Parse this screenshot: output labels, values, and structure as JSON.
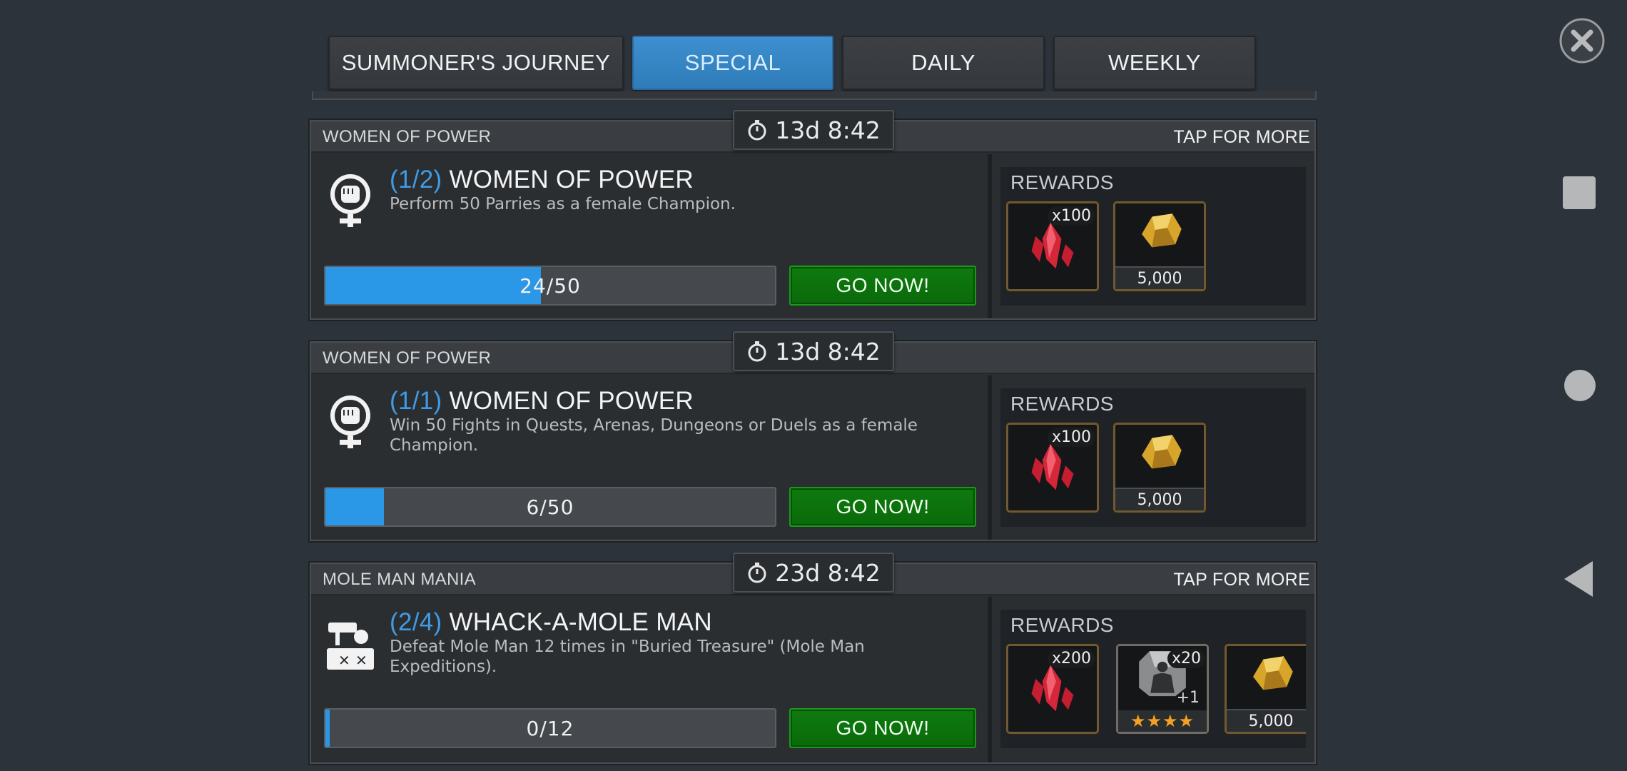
{
  "tabs": [
    {
      "label": "SUMMONER'S JOURNEY",
      "active": false
    },
    {
      "label": "SPECIAL",
      "active": true
    },
    {
      "label": "DAILY",
      "active": false
    },
    {
      "label": "WEEKLY",
      "active": false
    }
  ],
  "cards": [
    {
      "category": "WOMEN OF POWER",
      "tap_more": "TAP FOR MORE",
      "timer": "13d 8:42",
      "icon": "female-fist-icon",
      "progress_step": "(1/2)",
      "title": "WOMEN OF POWER",
      "description": "Perform 50 Parries as a female Champion.",
      "progress_text": "24/50",
      "progress_fraction": 0.48,
      "go_label": "GO NOW!",
      "rewards_title": "REWARDS",
      "rewards": [
        {
          "icon": "red-crystal-shard-icon",
          "count": "x100"
        },
        {
          "icon": "gold-nugget-icon",
          "label": "5,000"
        }
      ]
    },
    {
      "category": "WOMEN OF POWER",
      "tap_more": "",
      "timer": "13d 8:42",
      "icon": "female-fist-icon",
      "progress_step": "(1/1)",
      "title": "WOMEN OF POWER",
      "description": "Win 50 Fights in Quests, Arenas, Dungeons or Duels as a female Champion.",
      "progress_text": "6/50",
      "progress_fraction": 0.12,
      "go_label": "GO NOW!",
      "rewards_title": "REWARDS",
      "rewards": [
        {
          "icon": "red-crystal-shard-icon",
          "count": "x100"
        },
        {
          "icon": "gold-nugget-icon",
          "label": "5,000"
        }
      ]
    },
    {
      "category": "MOLE MAN MANIA",
      "tap_more": "TAP FOR MORE",
      "timer": "23d 8:42",
      "icon": "whack-mole-icon",
      "progress_step": "(2/4)",
      "title": "WHACK-A-MOLE MAN",
      "description": "Defeat Mole Man 12 times in \"Buried Treasure\" (Mole Man Expeditions).",
      "progress_text": "0/12",
      "progress_fraction": 0.0,
      "go_label": "GO NOW!",
      "rewards_title": "REWARDS",
      "rewards": [
        {
          "icon": "red-crystal-shard-icon",
          "count": "x200"
        },
        {
          "icon": "champion-silhouette-icon",
          "count": "x20",
          "badge": "+1",
          "stars": "★★★★"
        },
        {
          "icon": "gold-nugget-icon",
          "label": "5,000"
        }
      ]
    }
  ],
  "colors": {
    "active_tab": "#2f7cb9",
    "progress": "#2a98e6",
    "go_button": "#0a6a0a",
    "title_progress": "#3f9be6"
  },
  "nav": {
    "close": "close-icon",
    "square": "recent-apps-icon",
    "circle": "home-icon",
    "back": "back-icon"
  }
}
